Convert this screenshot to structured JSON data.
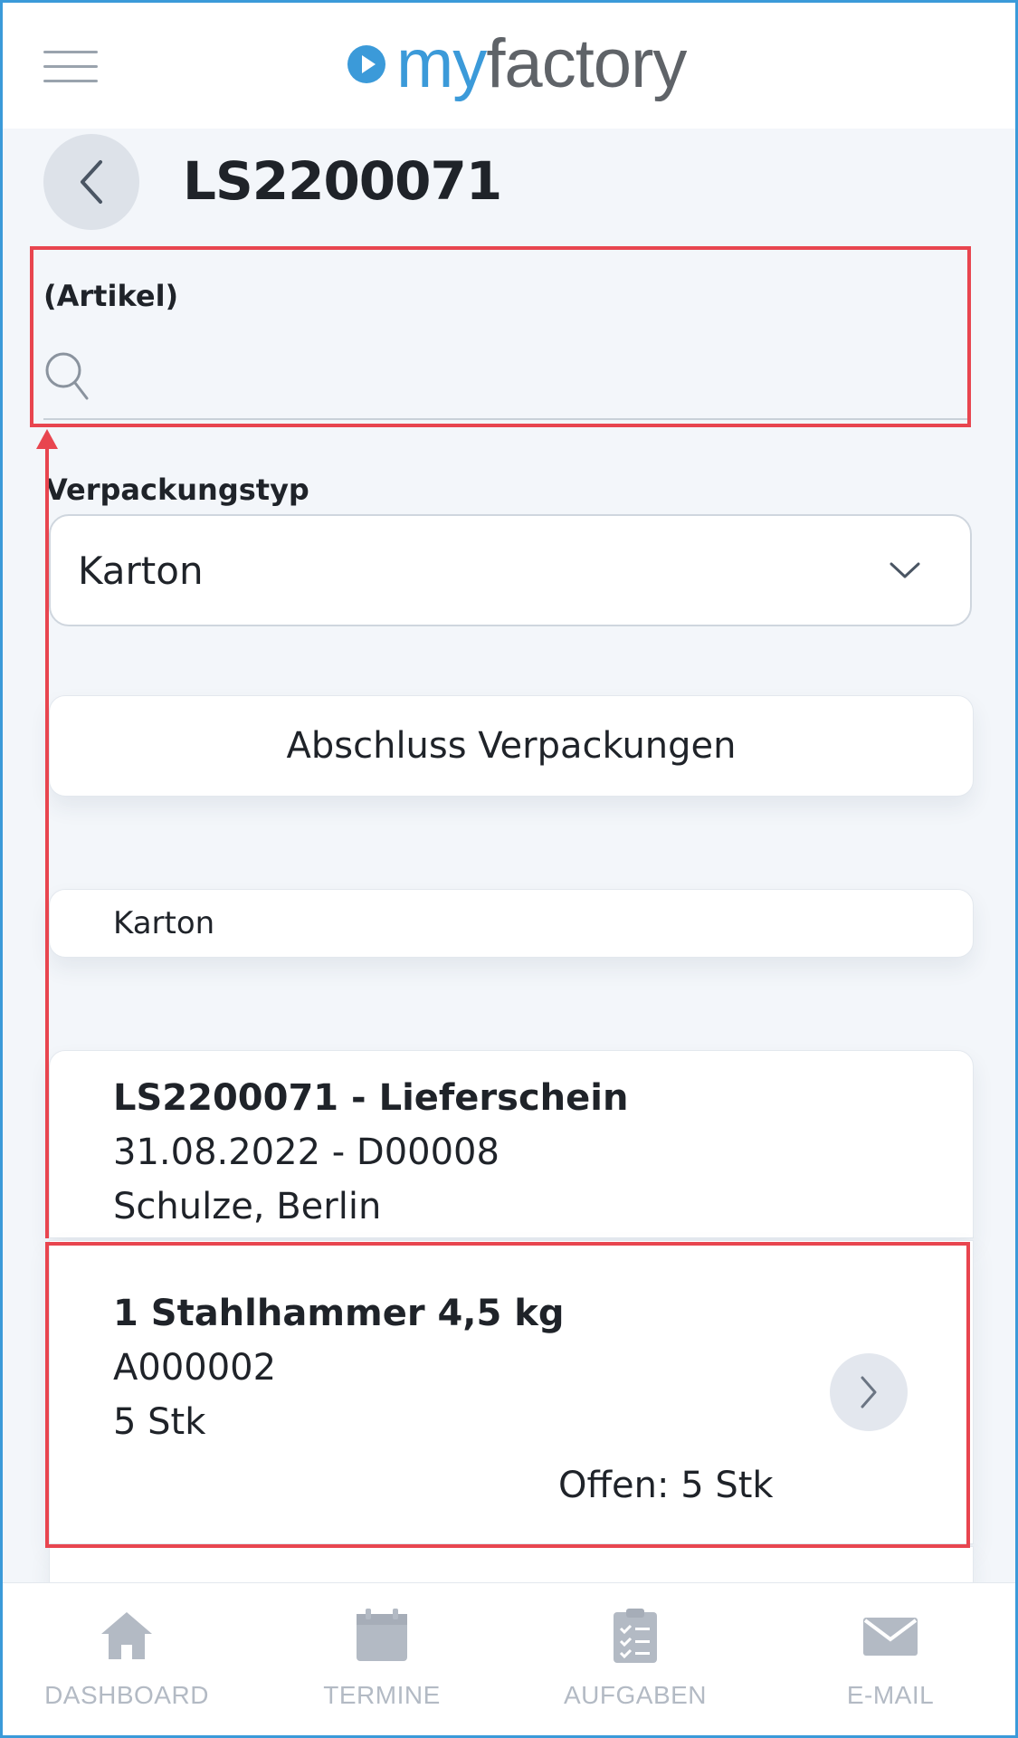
{
  "header": {
    "logo_my": "my",
    "logo_factory": "factory"
  },
  "page": {
    "title": "LS2200071"
  },
  "search": {
    "label": "(Artikel)",
    "value": "",
    "placeholder": ""
  },
  "packaging": {
    "label": "Verpackungstyp",
    "selected": "Karton"
  },
  "actions": {
    "finish_label": "Abschluss Verpackungen"
  },
  "package_list": {
    "items": [
      "Karton"
    ]
  },
  "delivery": {
    "line1": "LS2200071 - Lieferschein",
    "line2": "31.08.2022 - D00008",
    "line3": "Schulze, Berlin"
  },
  "line_item": {
    "title": "1 Stahlhammer 4,5 kg",
    "article_no": "A000002",
    "quantity": "5 Stk",
    "open": "Offen: 5 Stk"
  },
  "bottom_nav": {
    "items": [
      {
        "label": "DASHBOARD",
        "icon": "home-icon"
      },
      {
        "label": "TERMINE",
        "icon": "calendar-icon"
      },
      {
        "label": "AUFGABEN",
        "icon": "clipboard-icon"
      },
      {
        "label": "E-MAIL",
        "icon": "mail-icon"
      }
    ]
  },
  "colors": {
    "accent": "#3b9ad9",
    "highlight": "#e8454f",
    "nav_icon": "#b3bac4"
  }
}
